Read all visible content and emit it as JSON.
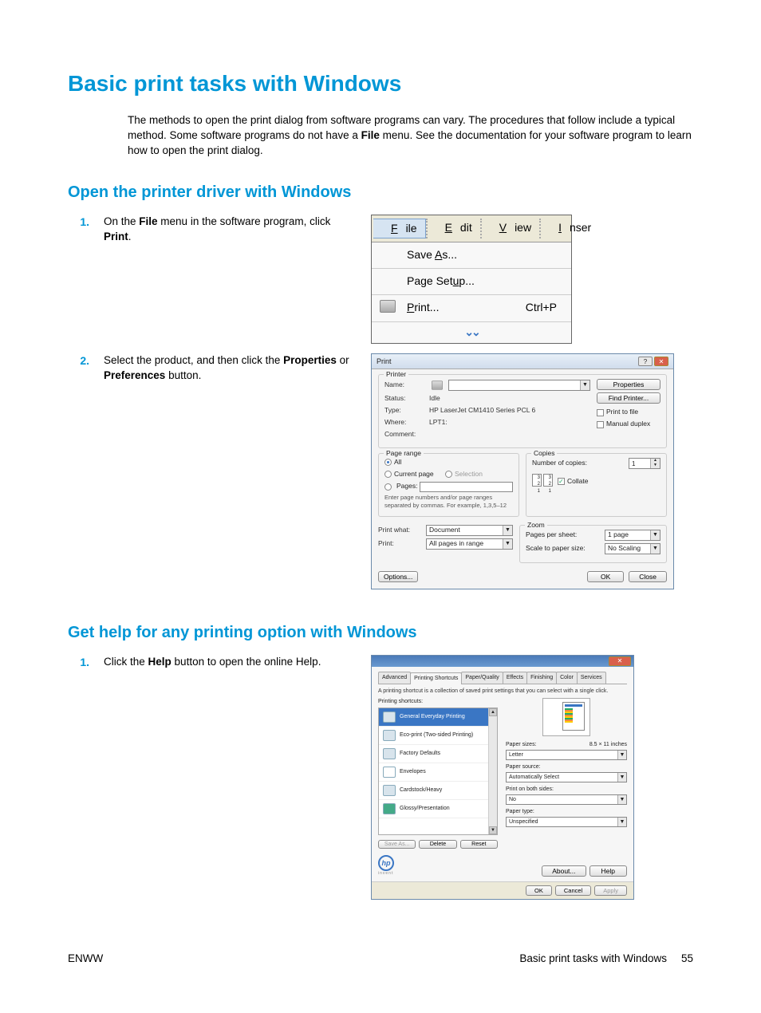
{
  "heading": "Basic print tasks with Windows",
  "intro_parts": {
    "before_file": "The methods to open the print dialog from software programs can vary. The procedures that follow include a typical method. Some software programs do not have a ",
    "file_word": "File",
    "after_file": " menu. See the documentation for your software program to learn how to open the print dialog."
  },
  "section1": {
    "title": "Open the printer driver with Windows",
    "step1": {
      "num": "1.",
      "before_file": "On the ",
      "file_word": "File",
      "middle": " menu in the software program, click ",
      "print_word": "Print",
      "after": "."
    },
    "step2": {
      "num": "2.",
      "before_props": "Select the product, and then click the ",
      "props_word": "Properties",
      "middle": " or ",
      "prefs_word": "Preferences",
      "after": " button."
    }
  },
  "filemenu": {
    "bar": {
      "file": "File",
      "edit": "Edit",
      "view": "View",
      "inser": "Inser"
    },
    "save_as": "Save As...",
    "page_setup": "Page Setup...",
    "print": "Print...",
    "print_shortcut": "Ctrl+P",
    "chev": "▾▾"
  },
  "printdlg": {
    "title": "Print",
    "printer_legend": "Printer",
    "name_label": "Name:",
    "status_label": "Status:",
    "status_val": "Idle",
    "type_label": "Type:",
    "type_val": "HP LaserJet CM1410 Series PCL 6",
    "where_label": "Where:",
    "where_val": "LPT1:",
    "comment_label": "Comment:",
    "properties_btn": "Properties",
    "find_printer_btn": "Find Printer...",
    "print_to_file": "Print to file",
    "manual_duplex": "Manual duplex",
    "pagerange_legend": "Page range",
    "all": "All",
    "current_page": "Current page",
    "selection": "Selection",
    "pages": "Pages:",
    "pages_note": "Enter page numbers and/or page ranges separated by commas. For example, 1,3,5–12",
    "copies_legend": "Copies",
    "num_copies_label": "Number of copies:",
    "num_copies_val": "1",
    "collate": "Collate",
    "print_what_label": "Print what:",
    "print_what_val": "Document",
    "print_label": "Print:",
    "print_val": "All pages in range",
    "zoom_legend": "Zoom",
    "pages_per_sheet_label": "Pages per sheet:",
    "pages_per_sheet_val": "1 page",
    "scale_label": "Scale to paper size:",
    "scale_val": "No Scaling",
    "options_btn": "Options...",
    "ok_btn": "OK",
    "close_btn": "Close"
  },
  "section2": {
    "title": "Get help for any printing option with Windows",
    "step1": {
      "num": "1.",
      "before_help": "Click the ",
      "help_word": "Help",
      "after": " button to open the online Help."
    }
  },
  "propdlg": {
    "tabs": [
      "Advanced",
      "Printing Shortcuts",
      "Paper/Quality",
      "Effects",
      "Finishing",
      "Color",
      "Services"
    ],
    "active_tab_index": 1,
    "desc": "A printing shortcut is a collection of saved print settings that you can select with a single click.",
    "shortcuts_label": "Printing shortcuts:",
    "shortcuts": [
      "General Everyday Printing",
      "Eco-print (Two-sided Printing)",
      "Factory Defaults",
      "Envelopes",
      "Cardstock/Heavy",
      "Glossy/Presentation"
    ],
    "paper_sizes_label": "Paper sizes:",
    "paper_sizes_dim": "8.5 × 11 inches",
    "paper_sizes_val": "Letter",
    "paper_source_label": "Paper source:",
    "paper_source_val": "Automatically Select",
    "print_both_label": "Print on both sides:",
    "print_both_val": "No",
    "paper_type_label": "Paper type:",
    "paper_type_val": "Unspecified",
    "save_as_btn": "Save As...",
    "delete_btn": "Delete",
    "reset_btn": "Reset",
    "about_btn": "About...",
    "help_btn": "Help",
    "ok_btn": "OK",
    "cancel_btn": "Cancel",
    "apply_btn": "Apply",
    "invent": "invent"
  },
  "footer": {
    "left": "ENWW",
    "right_text": "Basic print tasks with Windows",
    "page": "55"
  }
}
